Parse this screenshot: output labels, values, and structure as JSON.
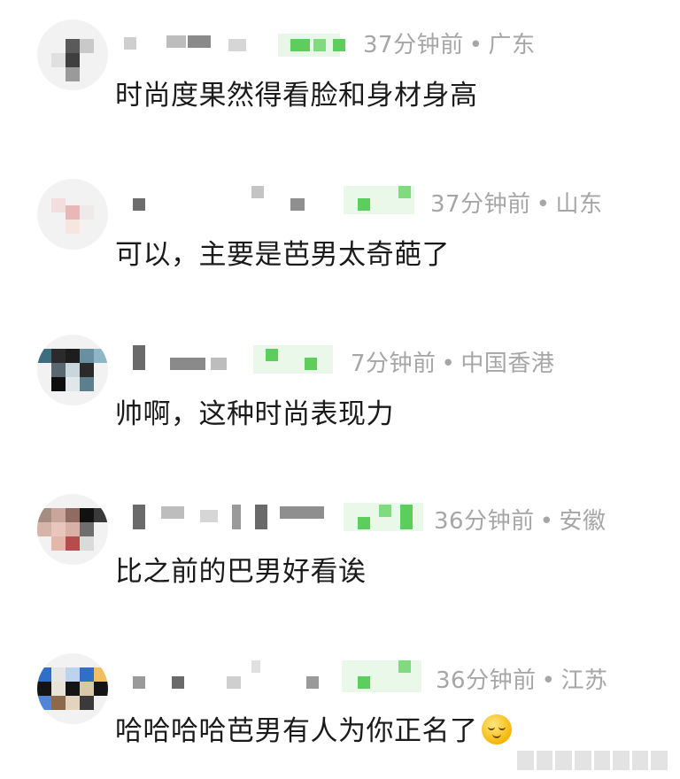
{
  "comments": [
    {
      "time": "37分钟前",
      "location": "广东",
      "text": "时尚度果然得看脸和身材身高",
      "avatar_icon": "user-avatar-icon",
      "name_obscured": true
    },
    {
      "time": "37分钟前",
      "location": "山东",
      "text": "可以，主要是芭男太奇葩了",
      "avatar_icon": "user-avatar-icon",
      "name_obscured": true
    },
    {
      "time": "7分钟前",
      "location": "中国香港",
      "text": "帅啊，这种时尚表现力",
      "avatar_icon": "user-avatar-icon",
      "name_obscured": true
    },
    {
      "time": "36分钟前",
      "location": "安徽",
      "text": "比之前的巴男好看诶",
      "avatar_icon": "user-avatar-icon",
      "name_obscured": true
    },
    {
      "time": "36分钟前",
      "location": "江苏",
      "text": "哈哈哈哈芭男有人为你正名了",
      "emoji": "relieved-face-icon",
      "avatar_icon": "user-avatar-icon",
      "name_obscured": true
    }
  ],
  "colors": {
    "meta_text": "#a6a6a6",
    "body_text": "#1a1a1a",
    "mosaic_green": "#5dce5d"
  }
}
